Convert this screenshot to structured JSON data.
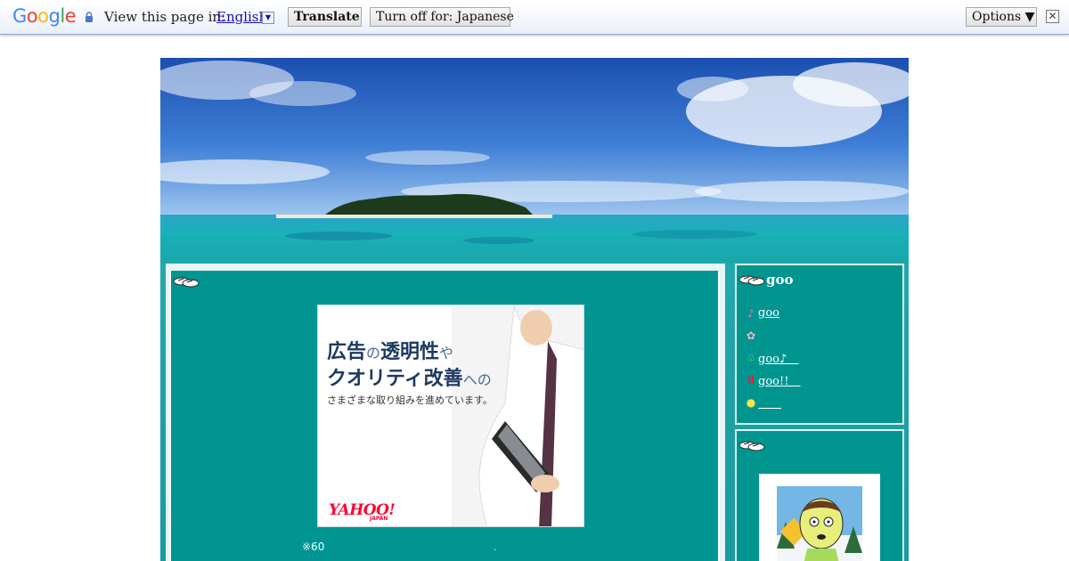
{
  "translate_bar": {
    "logo": [
      "G",
      "o",
      "o",
      "g",
      "l",
      "e"
    ],
    "view_label": "View this page in:",
    "language": "English",
    "language_arrow": "▼",
    "translate_button": "Translate",
    "turn_off_button": "Turn off for: Japanese",
    "options_button": "Options ▼",
    "close_button": "✕"
  },
  "main": {
    "ad": {
      "headline_1": [
        "広告",
        "の",
        "透明性",
        "や"
      ],
      "headline_2": [
        "クオリティ改善",
        "への"
      ],
      "subline": "さまざまな取り組みを進めています。",
      "brand": "YAHOO!",
      "brand_sub": "JAPAN"
    },
    "note": "※60",
    "note_dot": "."
  },
  "sidebar": {
    "box1": {
      "title": "goo",
      "items": [
        {
          "icon": "♪",
          "icon_name": "music-note-icon",
          "icon_color": "#ff6fae",
          "label": "goo"
        },
        {
          "icon": "✿",
          "icon_name": "flower-icon",
          "icon_color": "#ffb3c8",
          "label": ""
        },
        {
          "icon": "♧",
          "icon_name": "sprout-icon",
          "icon_color": "#7ed957",
          "label": "goo♪　"
        },
        {
          "icon": "‼",
          "icon_name": "double-exclamation-icon",
          "icon_color": "#e0203a",
          "label": "goo!!　"
        },
        {
          "icon": "●",
          "icon_name": "lightbulb-icon",
          "icon_color": "#ffe14d",
          "label": "　　"
        }
      ]
    }
  },
  "colors": {
    "panel_teal": "#019591",
    "sea_teal": "#1aa3a6",
    "link": "#1a0dab"
  }
}
